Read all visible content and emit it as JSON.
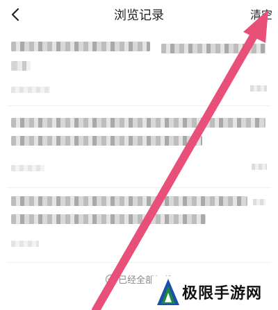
{
  "header": {
    "title": "浏览记录",
    "clear_label": "清空"
  },
  "footer": {
    "end_text": "已经全部加载"
  },
  "watermark": {
    "text": "极限手游网"
  },
  "colors": {
    "annotation_arrow": "#e8507a",
    "logo_green": "#1a8a3a",
    "logo_blue": "#1a4fb0"
  },
  "icons": {
    "back": "chevron-left-icon",
    "footer": "chevron-down-circle-icon"
  }
}
